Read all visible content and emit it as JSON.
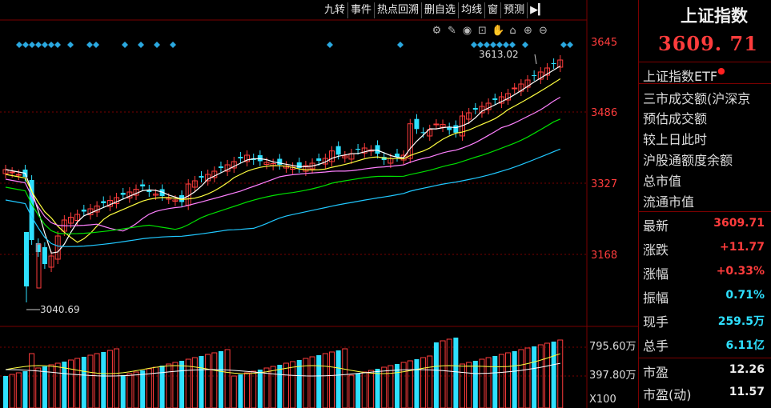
{
  "toolbar": {
    "buttons": [
      "九转",
      "事件",
      "热点回溯",
      "删自选",
      "均线",
      "窗",
      "预测"
    ]
  },
  "tool_icons": [
    "settings-icon",
    "pen-icon",
    "eye-icon",
    "lock-icon",
    "hand-icon",
    "unlock-icon",
    "zoom-in-icon",
    "zoom-out-icon"
  ],
  "price_axis": {
    "labels": [
      "3645",
      "3486",
      "3327",
      "3168"
    ],
    "high_marker": "3613.02",
    "low_marker": "3040.69"
  },
  "volume_axis": {
    "labels": [
      "795.60万",
      "397.80万",
      "X100"
    ]
  },
  "panel": {
    "title": "上证指数",
    "price": "3609. 71",
    "etf_label": "上证指数ETF",
    "info_lines": [
      "三市成交额(沪深京",
      "预估成交额",
      "较上日此时",
      "沪股通额度余额",
      "总市值",
      "流通市值"
    ],
    "rows": [
      {
        "label": "最新",
        "value": "3609.71",
        "color": "red"
      },
      {
        "label": "涨跌",
        "value": "+11.77",
        "color": "red"
      },
      {
        "label": "涨幅",
        "value": "+0.33%",
        "color": "red"
      },
      {
        "label": "振幅",
        "value": "0.71%",
        "color": "cyan"
      },
      {
        "label": "现手",
        "value": "259.5万",
        "color": "cyan"
      },
      {
        "label": "总手",
        "value": "6.11亿",
        "color": "cyan"
      },
      {
        "label": "市盈",
        "value": "12.26",
        "color": "white"
      },
      {
        "label": "市盈(动)",
        "value": "11.57",
        "color": "white"
      }
    ]
  },
  "colors": {
    "up": "#ff3c3c",
    "down": "#2ee0ff",
    "ma5": "#ffffff",
    "ma10": "#ffff40",
    "ma20": "#ff80ff",
    "ma30": "#00e000",
    "ma60": "#20c8ff",
    "grid": "#7a0000",
    "diamond": "#2aa8e0"
  }
}
